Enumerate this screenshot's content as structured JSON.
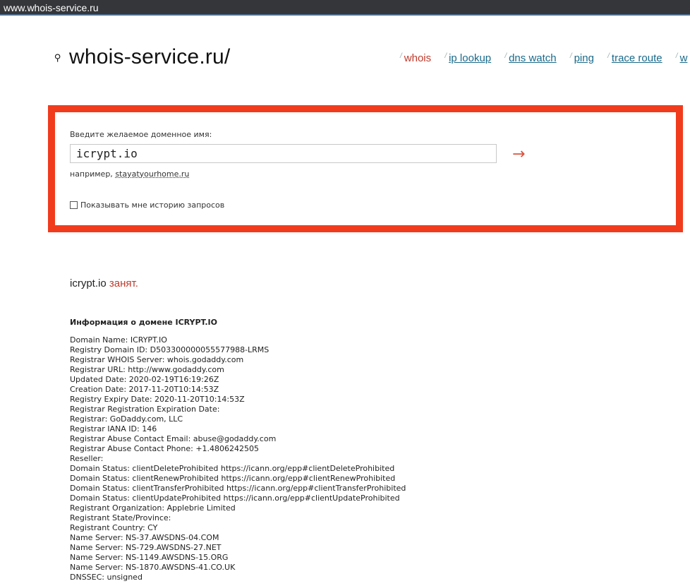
{
  "browser": {
    "url": "www.whois-service.ru"
  },
  "logo": {
    "text": "whois-service.ru/"
  },
  "nav": {
    "items": [
      {
        "label": "whois",
        "active": true
      },
      {
        "label": "ip lookup"
      },
      {
        "label": "dns watch"
      },
      {
        "label": "ping"
      },
      {
        "label": "trace route"
      },
      {
        "label": "w"
      }
    ],
    "separator": "/"
  },
  "search": {
    "label": "Введите желаемое доменное имя:",
    "value": "icrypt.io",
    "submit": "→",
    "example_prefix": "например, ",
    "example_link": "stayatyourhome.ru",
    "history_label": "Показывать мне историю запросов",
    "history_checked": false
  },
  "result": {
    "domain": "icrypt.io",
    "status": "занят."
  },
  "info": {
    "title": "Информация о домене ICRYPT.IO",
    "lines": [
      "Domain Name: ICRYPT.IO",
      "Registry Domain ID: D503300000055577988-LRMS",
      "Registrar WHOIS Server: whois.godaddy.com",
      "Registrar URL: http://www.godaddy.com",
      "Updated Date: 2020-02-19T16:19:26Z",
      "Creation Date: 2017-11-20T10:14:53Z",
      "Registry Expiry Date: 2020-11-20T10:14:53Z",
      "Registrar Registration Expiration Date:",
      "Registrar: GoDaddy.com, LLC",
      "Registrar IANA ID: 146",
      "Registrar Abuse Contact Email: abuse@godaddy.com",
      "Registrar Abuse Contact Phone: +1.4806242505",
      "Reseller:",
      "Domain Status: clientDeleteProhibited https://icann.org/epp#clientDeleteProhibited",
      "Domain Status: clientRenewProhibited https://icann.org/epp#clientRenewProhibited",
      "Domain Status: clientTransferProhibited https://icann.org/epp#clientTransferProhibited",
      "Domain Status: clientUpdateProhibited https://icann.org/epp#clientUpdateProhibited",
      "Registrant Organization: Applebrie Limited",
      "Registrant State/Province:",
      "Registrant Country: CY",
      "Name Server: NS-37.AWSDNS-04.COM",
      "Name Server: NS-729.AWSDNS-27.NET",
      "Name Server: NS-1149.AWSDNS-15.ORG",
      "Name Server: NS-1870.AWSDNS-41.CO.UK",
      "DNSSEC: unsigned"
    ]
  },
  "colors": {
    "accent": "#f13b1d",
    "link": "#1a6a8a",
    "taken": "#c0392b"
  }
}
